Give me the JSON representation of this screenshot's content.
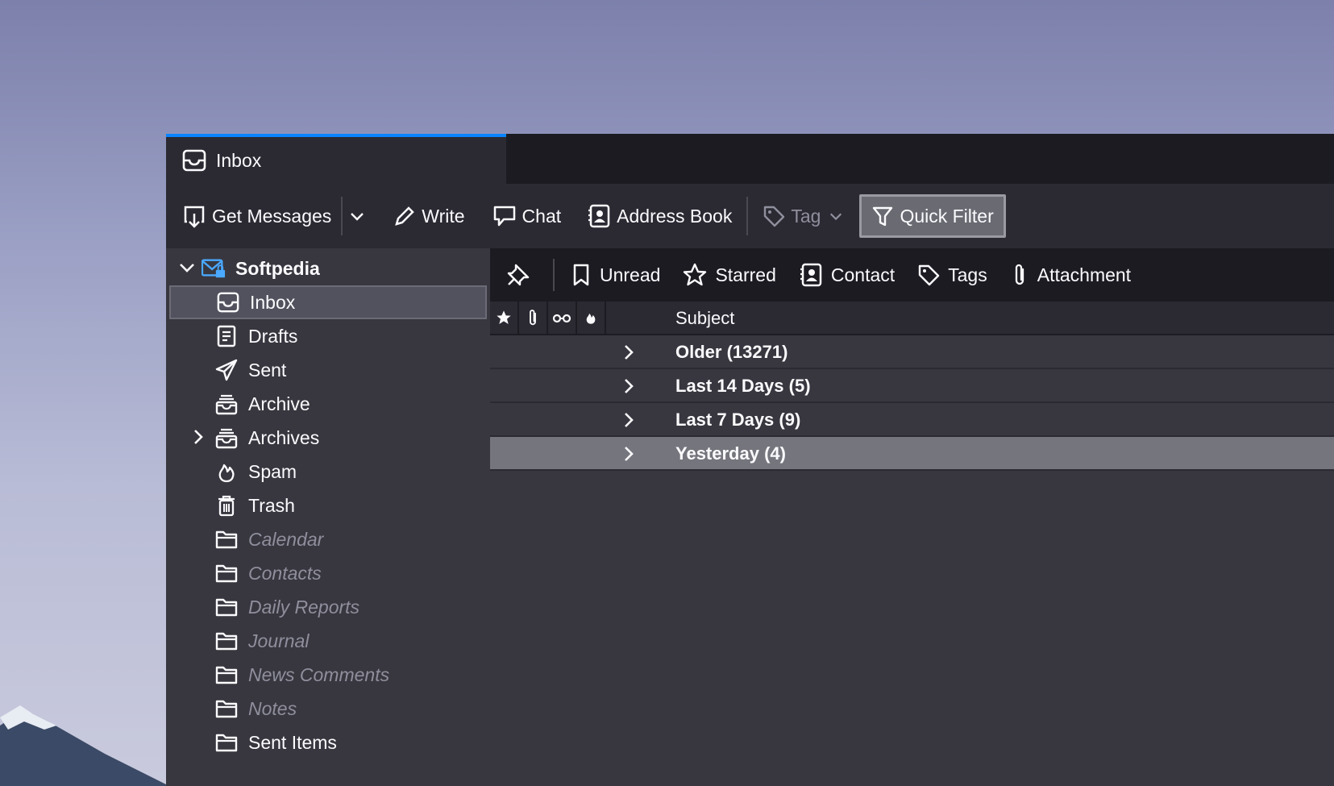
{
  "tab": {
    "title": "Inbox",
    "icon": "inbox-icon"
  },
  "toolbar": {
    "get_messages": "Get Messages",
    "write": "Write",
    "chat": "Chat",
    "address_book": "Address Book",
    "tag": "Tag",
    "quick_filter": "Quick Filter"
  },
  "account": {
    "name": "Softpedia"
  },
  "folders": [
    {
      "name": "Inbox",
      "icon": "inbox-icon",
      "selected": true
    },
    {
      "name": "Drafts",
      "icon": "drafts-icon"
    },
    {
      "name": "Sent",
      "icon": "sent-icon"
    },
    {
      "name": "Archive",
      "icon": "archive-icon"
    },
    {
      "name": "Archives",
      "icon": "archive-icon",
      "expandable": true
    },
    {
      "name": "Spam",
      "icon": "spam-icon"
    },
    {
      "name": "Trash",
      "icon": "trash-icon"
    },
    {
      "name": "Calendar",
      "icon": "folder-icon",
      "dim": true
    },
    {
      "name": "Contacts",
      "icon": "folder-icon",
      "dim": true
    },
    {
      "name": "Daily Reports",
      "icon": "folder-icon",
      "dim": true
    },
    {
      "name": "Journal",
      "icon": "folder-icon",
      "dim": true
    },
    {
      "name": "News Comments",
      "icon": "folder-icon",
      "dim": true
    },
    {
      "name": "Notes",
      "icon": "folder-icon",
      "dim": true
    },
    {
      "name": "Sent Items",
      "icon": "folder-icon"
    }
  ],
  "quick_filter": {
    "unread": "Unread",
    "starred": "Starred",
    "contact": "Contact",
    "tags": "Tags",
    "attachment": "Attachment"
  },
  "message_list": {
    "subject_header": "Subject",
    "groups": [
      {
        "label": "Older (13271)"
      },
      {
        "label": "Last 14 Days (5)"
      },
      {
        "label": "Last 7 Days (9)"
      },
      {
        "label": "Yesterday (4)",
        "selected": true
      }
    ]
  },
  "colors": {
    "accent": "#0a84ff",
    "window_bg": "#1c1b22",
    "toolbar_bg": "#2b2a33",
    "pane_bg": "#38373f",
    "selected_row": "#75757d"
  }
}
